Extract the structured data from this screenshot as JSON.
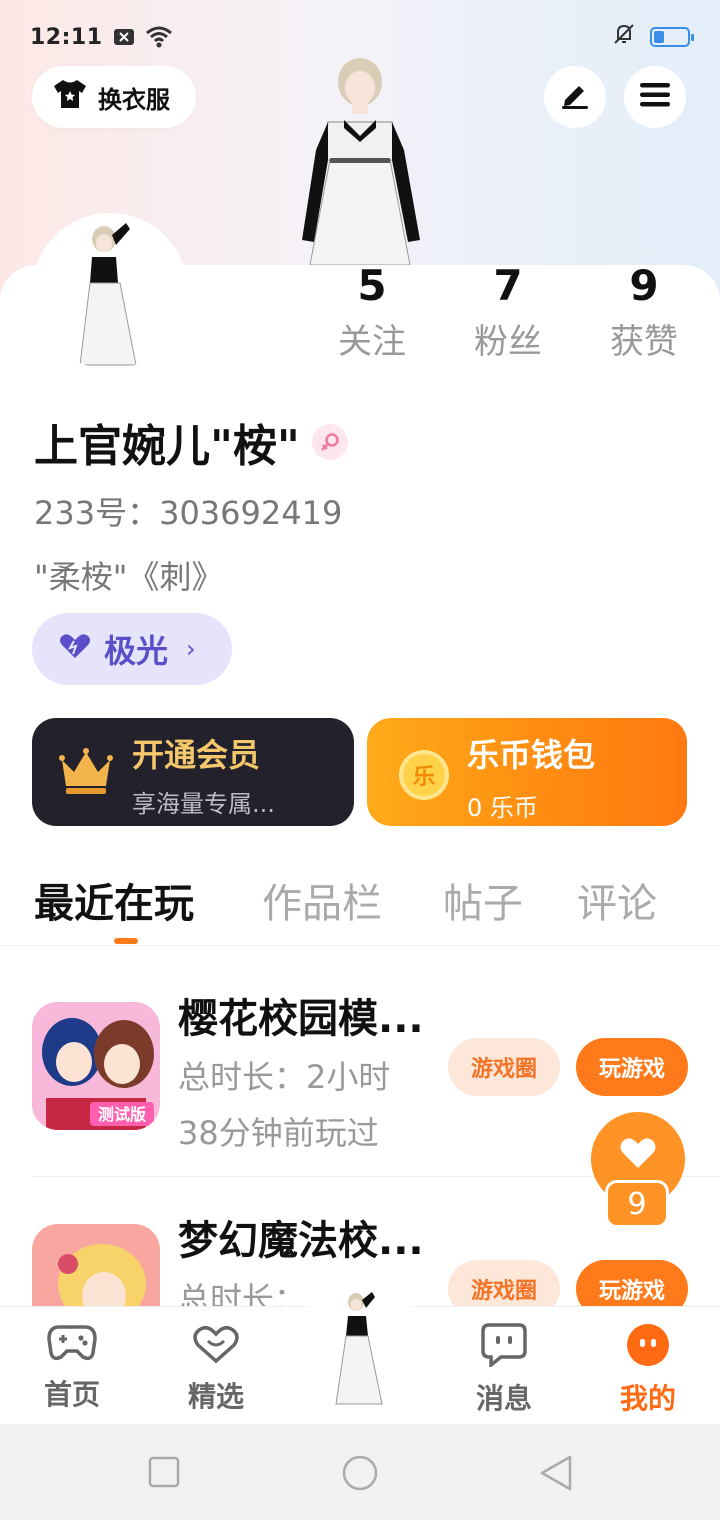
{
  "status_bar": {
    "time": "12:11",
    "icons": [
      "notification-icon",
      "wifi-icon",
      "mute-icon",
      "battery-icon"
    ]
  },
  "header": {
    "outfit_button_label": "换衣服",
    "edit_icon": "edit-icon",
    "menu_icon": "menu-icon"
  },
  "stats": [
    {
      "value": "5",
      "label": "关注"
    },
    {
      "value": "7",
      "label": "粉丝"
    },
    {
      "value": "9",
      "label": "获赞"
    }
  ],
  "profile": {
    "name": "上官婉儿\"桉\"",
    "gender": "female",
    "id_line": "233号：303692419",
    "bio": "\"柔桉\"《刺》",
    "badge_label": "极光"
  },
  "cards": {
    "vip_title": "开通会员",
    "vip_subtitle": "享海量专属...",
    "coin_title": "乐币钱包",
    "coin_subtitle": "0 乐币",
    "coin_icon_text": "乐"
  },
  "tabs": [
    "最近在玩",
    "作品栏",
    "帖子",
    "评论"
  ],
  "games": [
    {
      "title": "樱花校园模...",
      "duration": "总时长：2小时",
      "last_played": "38分钟前玩过",
      "circle_label": "游戏圈",
      "play_label": "玩游戏",
      "icon_badge": "测试版"
    },
    {
      "title": "梦幻魔法校...",
      "duration": "总时长：",
      "circle_label": "游戏圈",
      "play_label": "玩游戏"
    }
  ],
  "like_float": {
    "count": "9"
  },
  "bottom_nav": [
    {
      "label": "首页",
      "icon": "gamepad-icon"
    },
    {
      "label": "精选",
      "icon": "heart-chat-icon"
    },
    {
      "label": "",
      "icon": "avatar-center"
    },
    {
      "label": "消息",
      "icon": "message-icon"
    },
    {
      "label": "我的",
      "icon": "profile-icon",
      "active": true
    }
  ],
  "colors": {
    "accent": "#ff7a1a",
    "aurora": "#5a4fc9",
    "vip_gold": "#f4c76a"
  }
}
